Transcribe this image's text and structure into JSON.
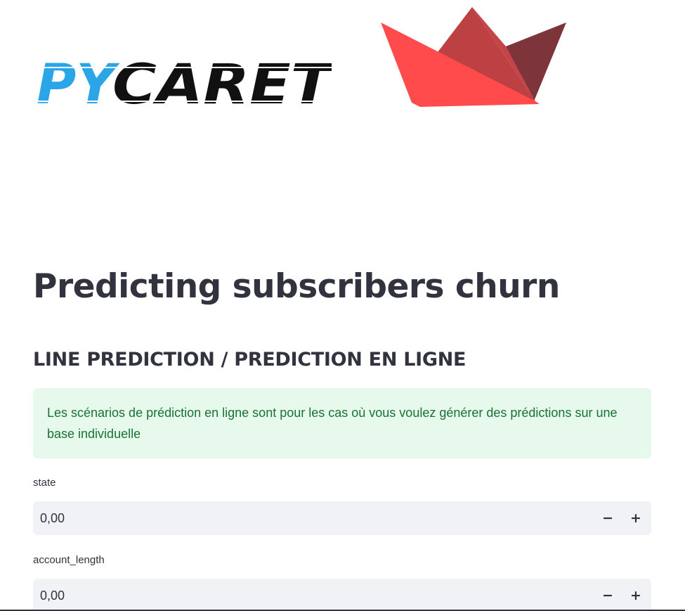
{
  "logos": {
    "pycaret_wordmark": "PYCARET",
    "pycaret_colors": {
      "py": "#2aa6e8",
      "caret": "#111111"
    },
    "streamlit_colors": [
      "#ff4b4b",
      "#bd4043",
      "#7d353b"
    ]
  },
  "title": "Predicting subscribers churn",
  "subtitle": "LINE PREDICTION / PREDICTION EN LIGNE",
  "info": {
    "text": "Les scénarios de prédiction en ligne sont pour les cas où vous voulez générer des prédictions sur une base individuelle",
    "colors": {
      "background": "#e7f8ec",
      "text": "#177233"
    }
  },
  "fields": [
    {
      "label": "state",
      "value": "0,00",
      "minus": "−",
      "plus": "+"
    },
    {
      "label": "account_length",
      "value": "0,00",
      "minus": "−",
      "plus": "+"
    }
  ]
}
